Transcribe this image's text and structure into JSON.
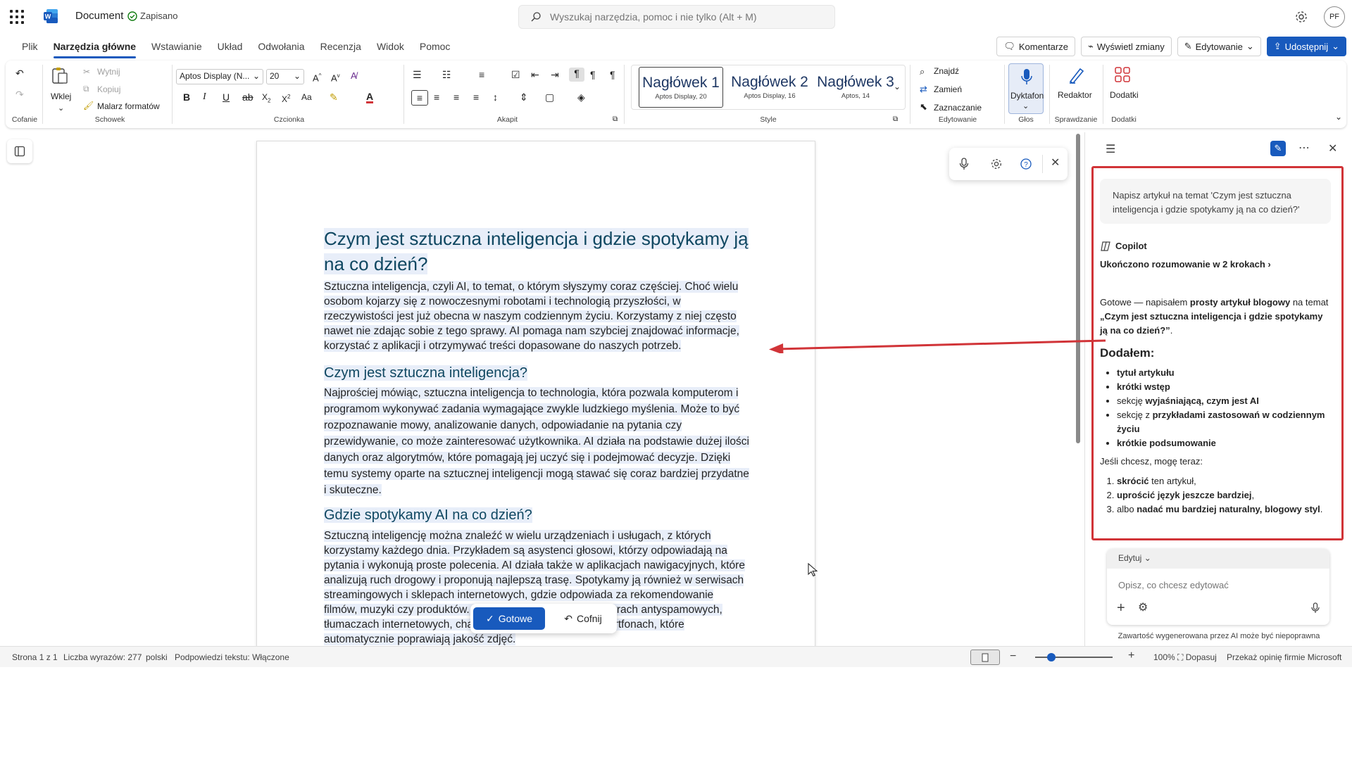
{
  "titlebar": {
    "doc_title": "Document",
    "saved": "Zapisano",
    "search_placeholder": "Wyszukaj narzędzia, pomoc i nie tylko (Alt + M)",
    "avatar": "PF"
  },
  "tabs": [
    "Plik",
    "Narzędzia główne",
    "Wstawianie",
    "Układ",
    "Odwołania",
    "Recenzja",
    "Widok",
    "Pomoc"
  ],
  "actions": {
    "comments": "Komentarze",
    "changes": "Wyświetl zmiany",
    "editing": "Edytowanie",
    "share": "Udostępnij"
  },
  "ribbon": {
    "undo_group": "Cofanie",
    "paste": "Wklej",
    "cut": "Wytnij",
    "copy": "Kopiuj",
    "format_painter": "Malarz formatów",
    "clipboard_group": "Schowek",
    "font_name": "Aptos Display (N...",
    "font_size": "20",
    "font_group": "Czcionka",
    "paragraph_group": "Akapit",
    "styles": [
      {
        "name": "Nagłówek 1",
        "sub": "Aptos Display, 20"
      },
      {
        "name": "Nagłówek 2",
        "sub": "Aptos Display, 16"
      },
      {
        "name": "Nagłówek 3",
        "sub": "Aptos, 14"
      }
    ],
    "styles_group": "Style",
    "find": "Znajdź",
    "replace": "Zamień",
    "select": "Zaznaczanie",
    "editing_group": "Edytowanie",
    "dictate": "Dyktafon",
    "voice_group": "Głos",
    "editor": "Redaktor",
    "proofing_group": "Sprawdzanie",
    "addins": "Dodatki",
    "addins_group": "Dodatki"
  },
  "document": {
    "title": "Czym jest sztuczna inteligencja i gdzie spotykamy ją na co dzień?",
    "intro": "Sztuczna inteligencja, czyli AI, to temat, o którym słyszymy coraz częściej. Choć wielu osobom kojarzy się z nowoczesnymi robotami i technologią przyszłości, w rzeczywistości jest już obecna w naszym codziennym życiu. Korzystamy z niej często nawet nie zdając sobie z tego sprawy. AI pomaga nam szybciej znajdować informacje, korzystać z aplikacji i otrzymywać treści dopasowane do naszych potrzeb.",
    "h2a": "Czym jest sztuczna inteligencja?",
    "p2": "Najprościej mówiąc, sztuczna inteligencja to technologia, która pozwala komputerom i programom wykonywać zadania wymagające zwykle ludzkiego myślenia. Może to być rozpoznawanie mowy, analizowanie danych, odpowiadanie na pytania czy przewidywanie, co może zainteresować użytkownika. AI działa na podstawie dużej ilości danych oraz algorytmów, które pomagają jej uczyć się i podejmować decyzje. Dzięki temu systemy oparte na sztucznej inteligencji mogą stawać się coraz bardziej przydatne i skuteczne.",
    "h2b": "Gdzie spotykamy AI na co dzień?",
    "p3": "Sztuczną inteligencję można znaleźć w wielu urządzeniach i usługach, z których korzystamy każdego dnia. Przykładem są asystenci głosowi, którzy odpowiadają na pytania i wykonują proste polecenia. AI działa także w aplikacjach nawigacyjnych, które analizują ruch drogowy i proponują najlepszą trasę. Spotykamy ją również w serwisach streamingowych i sklepach internetowych, gdzie odpowiada za rekomendowanie filmów, muzyki czy produktów. Wykorzystywana jest też w filtrach antyspamowych, tłumaczach internetowych, chatbotach czy aparatach w smartfonach, które automatycznie poprawiają jakość zdjęć.",
    "done": "Gotowe",
    "undo": "Cofnij"
  },
  "copilot": {
    "prompt": "Napisz artykuł na temat 'Czym jest sztuczna inteligencja i gdzie spotykamy ją na co dzień?'",
    "name": "Copilot",
    "reasoning": "Ukończono rozumowanie w 2 krokach",
    "response_a": "Gotowe — napisałem ",
    "response_b": "prosty artykuł blogowy",
    "response_c": " na temat ",
    "response_d": "„Czym jest sztuczna inteligencja i gdzie spotykamy ją na co dzień?”",
    "response_e": ".",
    "added_heading": "Dodałem:",
    "added": [
      {
        "plain": "",
        "bold": "tytuł artykułu"
      },
      {
        "plain": "",
        "bold": "krótki wstęp"
      },
      {
        "plain": "sekcję ",
        "bold": "wyjaśniającą, czym jest AI"
      },
      {
        "plain": "sekcję z ",
        "bold": "przykładami zastosowań w codziennym życiu"
      },
      {
        "plain": "",
        "bold": "krótkie podsumowanie"
      }
    ],
    "offer": "Jeśli chcesz, mogę teraz:",
    "options": [
      {
        "bold": "skrócić",
        "plain": " ten artykuł,"
      },
      {
        "bold": "uprościć język jeszcze bardziej",
        "plain": ","
      },
      {
        "pre": "albo ",
        "bold": "nadać mu bardziej naturalny, blogowy styl",
        "plain": "."
      }
    ],
    "mode": "Edytuj",
    "input_placeholder": "Opisz, co chcesz edytować",
    "disclaimer": "Zawartość wygenerowana przez AI może być niepoprawna"
  },
  "status": {
    "page": "Strona 1 z 1",
    "words": "Liczba wyrazów: 277",
    "lang": "polski",
    "predictions": "Podpowiedzi tekstu: Włączone",
    "zoom": "100%",
    "fit": "Dopasuj",
    "feedback": "Przekaż opinię firmie Microsoft"
  },
  "colors": {
    "accent": "#185abd",
    "annotation": "#d13438",
    "heading": "#0f4761"
  }
}
